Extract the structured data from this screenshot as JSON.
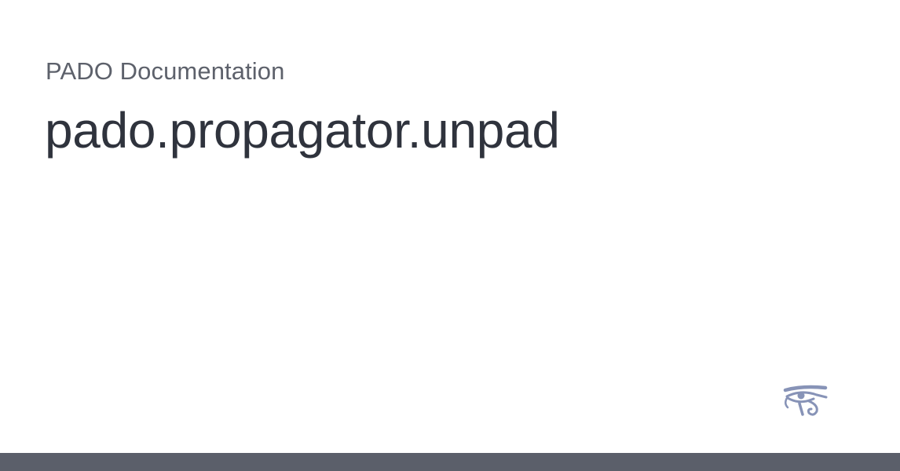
{
  "header": {
    "site_name": "PADO Documentation"
  },
  "main": {
    "page_title": "pado.propagator.unpad"
  },
  "branding": {
    "logo_icon": "eye-of-horus-icon",
    "logo_color": "#8793b7"
  },
  "footer": {
    "bar_color": "#5b5f6a"
  }
}
